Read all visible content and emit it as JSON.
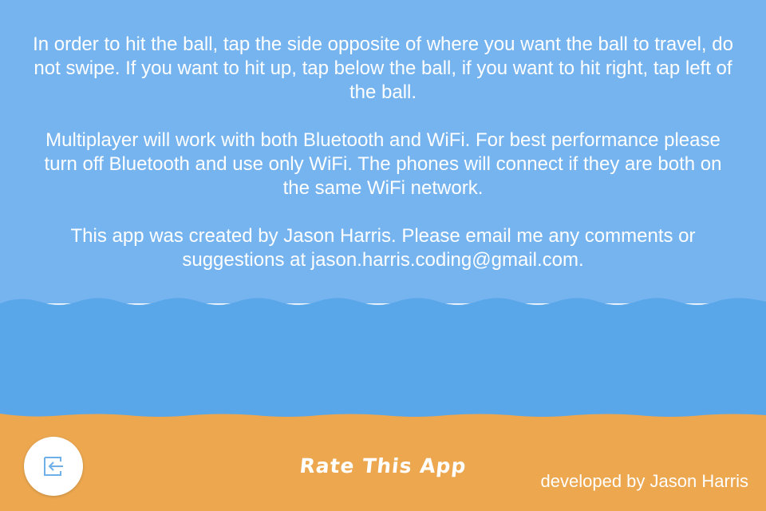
{
  "colors": {
    "sky": "#76b4f0",
    "sea": "#59a6e9",
    "sand": "#eca74f",
    "text": "#ffffff",
    "icon": "#6fb0e8"
  },
  "instructions": {
    "paragraph_1": "In order to hit the ball, tap the side opposite of where you want the ball to travel, do not swipe. If you want to hit up, tap below the ball, if you want to hit right, tap left of the ball.",
    "paragraph_2": "Multiplayer will work with both Bluetooth and WiFi. For best performance please turn off Bluetooth and use only WiFi. The phones will connect if they are both on the same WiFi network.",
    "paragraph_3": "This app was created by Jason Harris.  Please email me any comments or suggestions at jason.harris.coding@gmail.com."
  },
  "footer": {
    "back_icon": "exit-arrow-icon",
    "rate_label": "Rate This App",
    "developer_credit": "developed by Jason Harris"
  }
}
